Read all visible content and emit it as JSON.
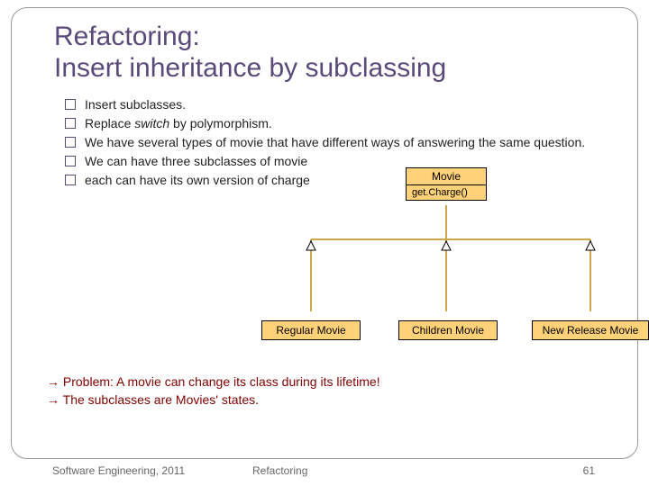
{
  "title_line1": "Refactoring:",
  "title_line2": "Insert inheritance by subclassing",
  "bullets": {
    "b1": "Insert subclasses.",
    "b2_pre": "Replace ",
    "b2_em": "switch",
    "b2_post": " by polymorphism.",
    "b3": "We have several types of movie that have different ways of answering the same question.",
    "b4": "We can have three subclasses of movie",
    "b5": "each can have its own version of charge"
  },
  "diagram": {
    "movie_name": "Movie",
    "movie_method": "get.Charge()",
    "sub1": "Regular Movie",
    "sub2": "Children Movie",
    "sub3": "New Release Movie"
  },
  "problem": {
    "arrow": "→",
    "line1": " Problem: A movie can change its class during its lifetime!",
    "line2": " The subclasses are Movies' states."
  },
  "footer": {
    "left": "Software Engineering, 2011",
    "center": "Refactoring",
    "page": "61"
  }
}
